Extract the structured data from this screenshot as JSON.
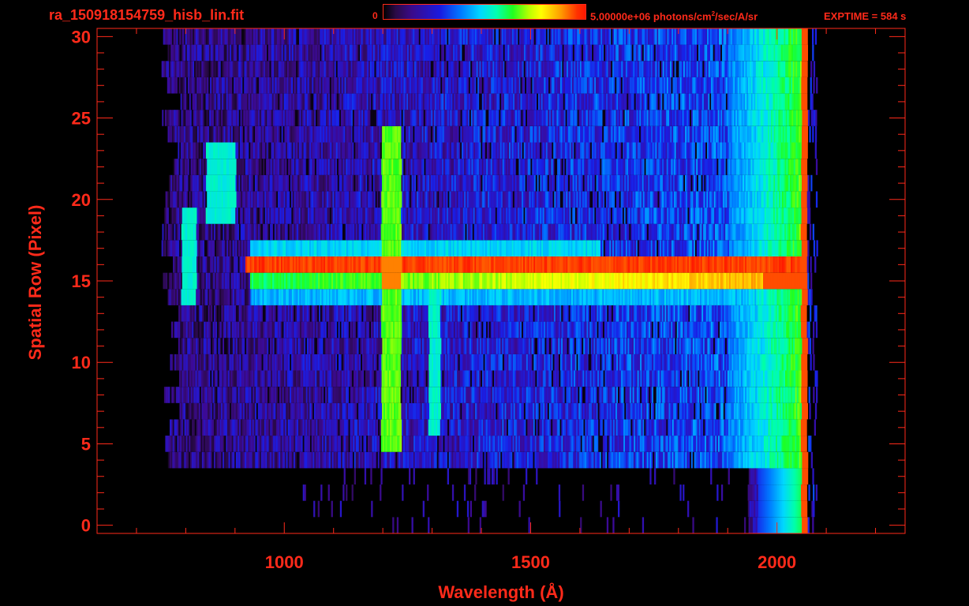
{
  "header": {
    "filename": "ra_150918154759_hisb_lin.fit",
    "colorbar_min": "0",
    "colorbar_max_prefix": "5.00000e+06 photons/cm",
    "colorbar_max_sup": "2",
    "colorbar_max_suffix": "/sec/A/sr",
    "exptime": "EXPTIME = 584 s"
  },
  "colors": {
    "axis": "#ff2a1a",
    "background": "#000000"
  },
  "chart_data": {
    "type": "heatmap",
    "title": "",
    "xlabel": "Wavelength (Å)",
    "ylabel": "Spatial Row (Pixel)",
    "xlim": [
      620,
      2260
    ],
    "ylim": [
      -0.5,
      30.5
    ],
    "x_ticks": [
      1000,
      1500,
      2000
    ],
    "x_tick_labels": [
      "1000",
      "1500",
      "2000"
    ],
    "y_ticks": [
      0,
      5,
      10,
      15,
      20,
      25,
      30
    ],
    "y_tick_labels": [
      "0",
      "5",
      "10",
      "15",
      "20",
      "25",
      "30"
    ],
    "colorbar": {
      "min": 0,
      "max": 5000000,
      "units": "photons/cm^2/sec/A/sr"
    },
    "data_extent": {
      "wavelength_min": 790,
      "wavelength_max": 2060,
      "row_min": 0,
      "row_max": 30
    },
    "features": [
      {
        "type": "emission_band_rows",
        "rows": [
          15,
          16
        ],
        "wavelength_range": [
          920,
          2060
        ],
        "level": "saturated"
      },
      {
        "type": "emission_line",
        "wavelength": 1216,
        "rows": [
          5,
          24
        ],
        "level": "high"
      },
      {
        "type": "emission_line",
        "wavelength": 1304,
        "rows": [
          6,
          14
        ],
        "level": "medium"
      },
      {
        "type": "edge_strip",
        "wavelength": 2055,
        "rows": [
          0,
          30
        ],
        "level": "saturated"
      },
      {
        "type": "arc_feature",
        "wavelength_range": [
          790,
          900
        ],
        "rows": [
          14,
          23
        ],
        "level": "medium"
      }
    ]
  }
}
